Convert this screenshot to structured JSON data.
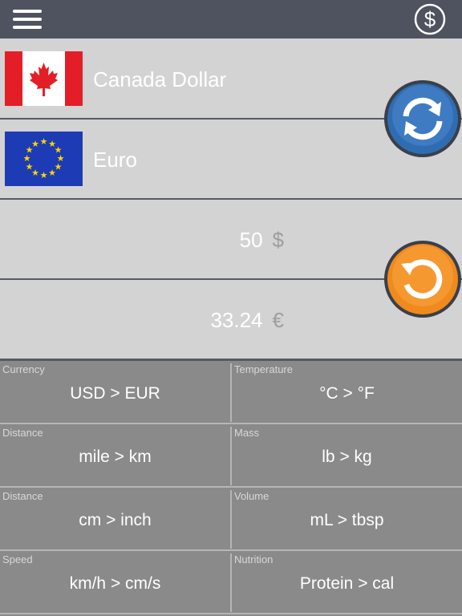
{
  "header": {
    "menu_icon": "hamburger-menu-icon",
    "currency_icon": "dollar-circle-icon"
  },
  "from_currency": {
    "name": "Canada Dollar",
    "flag_icon": "canada-flag-icon"
  },
  "to_currency": {
    "name": "Euro",
    "flag_icon": "eu-flag-icon"
  },
  "swap_button": {
    "icon": "swap-arrows-icon",
    "color": "#2f6db3"
  },
  "reset_button": {
    "icon": "refresh-icon",
    "color": "#f08a1c"
  },
  "input_amount": {
    "value": "50",
    "symbol": "$"
  },
  "output_amount": {
    "value": "33.24",
    "symbol": "€"
  },
  "converters": [
    {
      "category": "Currency",
      "conversion": "USD > EUR"
    },
    {
      "category": "Temperature",
      "conversion": "°C > °F"
    },
    {
      "category": "Distance",
      "conversion": "mile > km"
    },
    {
      "category": "Mass",
      "conversion": "lb > kg"
    },
    {
      "category": "Distance",
      "conversion": "cm > inch"
    },
    {
      "category": "Volume",
      "conversion": "mL > tbsp"
    },
    {
      "category": "Speed",
      "conversion": "km/h > cm/s"
    },
    {
      "category": "Nutrition",
      "conversion": "Protein > cal"
    }
  ],
  "colors": {
    "header_bg": "#4e535f",
    "panel_bg": "#d3d3d3",
    "grid_bg": "#8a8a8a"
  }
}
